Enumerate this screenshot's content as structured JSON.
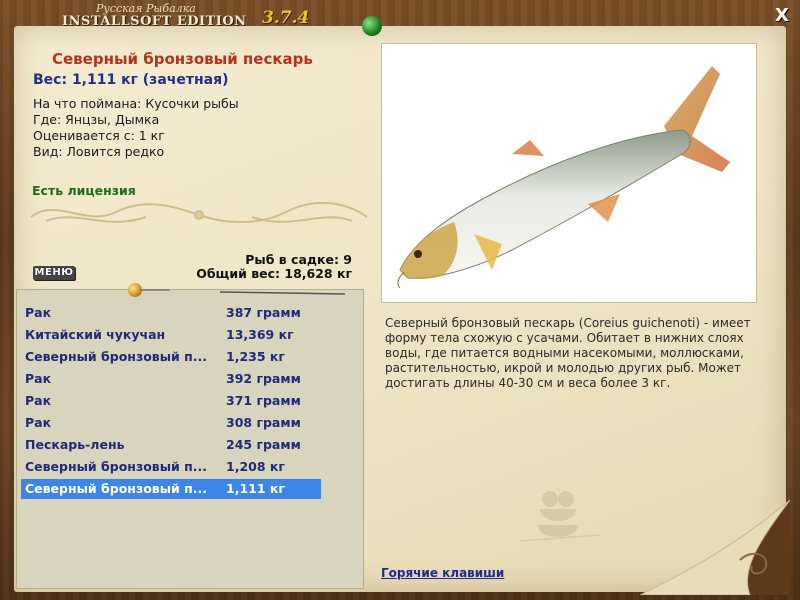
{
  "header": {
    "title_small": "Русская Рыбалка",
    "title_main": "INSTALLSOFT EDITION",
    "version": "3.7.4",
    "close_label": "X"
  },
  "fish": {
    "name": "Северный бронзовый пескарь",
    "weight": "Вес: 1,111 кг (зачетная)",
    "caught_on": "На что поймана: Кусочки рыбы",
    "where": "Где: Янцзы, Дымка",
    "rated_from": "Оценивается с: 1 кг",
    "kind": "Вид: Ловится редко",
    "license": "Есть лицензия",
    "description": "Северный бронзовый пескарь (Coreius guichenoti) - имеет форму тела схожую с усачами. Обитает в нижних слоях воды, где питается водными насекомыми, моллюсками, растительностью, икрой и молодью других рыб. Может достигать длины 40-30 см и веса более 3 кг."
  },
  "keepnet": {
    "count": "Рыб в садке: 9",
    "total": "Общий вес: 18,628 кг"
  },
  "menu_label": "МЕНЮ",
  "catch_list": [
    {
      "name": "Рак",
      "weight": "387 грамм"
    },
    {
      "name": "Китайский чукучан",
      "weight": "13,369 кг"
    },
    {
      "name": "Северный бронзовый п...",
      "weight": "1,235 кг"
    },
    {
      "name": "Рак",
      "weight": "392 грамм"
    },
    {
      "name": "Рак",
      "weight": "371 грамм"
    },
    {
      "name": "Рак",
      "weight": "308 грамм"
    },
    {
      "name": "Пескарь-лень",
      "weight": "245 грамм"
    },
    {
      "name": "Северный бронзовый п...",
      "weight": "1,208 кг"
    },
    {
      "name": "Северный бронзовый п...",
      "weight": "1,111 кг"
    }
  ],
  "selected_index": 8,
  "hotkeys_label": "Горячие клавиши",
  "colors": {
    "fish_name": "#b8321a",
    "weight": "#1f2f8a",
    "license": "#1a6a1a",
    "list_text": "#1f2a7a",
    "selection": "#3d86e8"
  }
}
